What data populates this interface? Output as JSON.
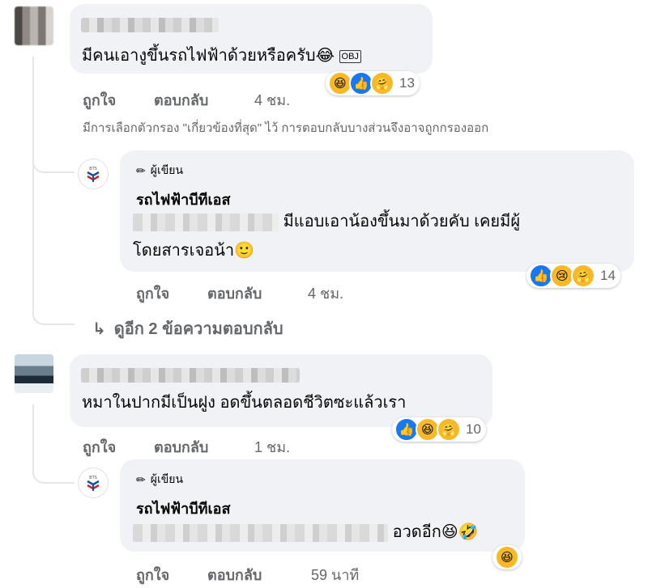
{
  "colors": {
    "bubble_bg": "#f0f2f5",
    "meta_text": "#65676b",
    "like_blue": "#1877f2",
    "emoji_yellow": "#f7b928"
  },
  "comments": [
    {
      "text": "มีคนเอางูขึ้นรถไฟฟ้าด้วยหรือครับ😂",
      "obj": "OBJ",
      "reactions": {
        "icons": [
          "haha-emoji",
          "like-icon",
          "care-emoji"
        ],
        "count": "13"
      },
      "actions": {
        "like": "ถูกใจ",
        "reply": "ตอบกลับ",
        "time": "4 ชม."
      },
      "filter_note": "มีการเลือกตัวกรอง \"เกี่ยวข้องที่สุด\" ไว้ การตอบกลับบางส่วนจึงอาจถูกกรองออก",
      "reply": {
        "author_tag": "ผู้เขียน",
        "author_name": "รถไฟฟ้าบีทีเอส",
        "text_line1": "มีแอบเอาน้องขึ้นมาด้วยคับ เคยมีผู้",
        "text_line2": "โดยสารเจอน้า🙂",
        "reactions": {
          "icons": [
            "like-icon",
            "sad-emoji",
            "care-emoji"
          ],
          "count": "14"
        },
        "actions": {
          "like": "ถูกใจ",
          "reply": "ตอบกลับ",
          "time": "4 ชม."
        }
      },
      "more_replies": "ดูอีก 2 ข้อความตอบกลับ"
    },
    {
      "text": "หมาในปากมีเป็นฝูง อดขึ้นตลอดชีวิตซะแล้วเรา",
      "reactions": {
        "icons": [
          "like-icon",
          "haha-emoji",
          "care-emoji"
        ],
        "count": "10"
      },
      "actions": {
        "like": "ถูกใจ",
        "reply": "ตอบกลับ",
        "time": "1 ชม."
      },
      "reply": {
        "author_tag": "ผู้เขียน",
        "author_name": "รถไฟฟ้าบีทีเอส",
        "text": "อวดอีก😆🤣",
        "reactions": {
          "icons": [
            "haha-emoji"
          ],
          "count": ""
        },
        "actions": {
          "like": "ถูกใจ",
          "reply": "ตอบกลับ",
          "time": "59 นาที"
        }
      }
    }
  ],
  "bts_logo_text": "BTS"
}
